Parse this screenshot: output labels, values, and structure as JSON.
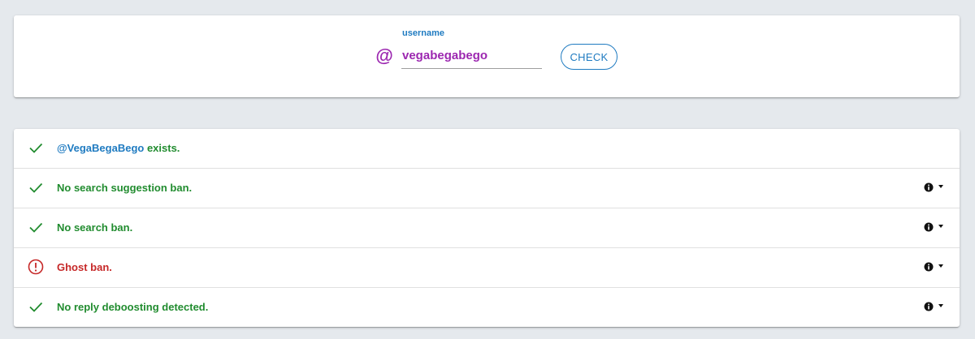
{
  "search": {
    "label": "username",
    "value": "vegabegabego",
    "at_symbol": "@",
    "check_label": "CHECK"
  },
  "results": [
    {
      "status": "ok",
      "handle": "@VegaBegaBego",
      "text": " exists.",
      "details": false
    },
    {
      "status": "ok",
      "handle": "",
      "text": "No search suggestion ban.",
      "details": true
    },
    {
      "status": "ok",
      "handle": "",
      "text": "No search ban.",
      "details": true
    },
    {
      "status": "warning",
      "handle": "",
      "text": "Ghost ban.",
      "details": true
    },
    {
      "status": "ok",
      "handle": "",
      "text": "No reply deboosting detected.",
      "details": true
    }
  ],
  "colors": {
    "background": "#e5e9ed",
    "accent_blue": "#1f7bc1",
    "accent_purple": "#9c27b0",
    "ok_green": "#218c2f",
    "warning_red": "#c62828",
    "input_text": "#9c27b0"
  },
  "icons": {
    "ok": "check-icon",
    "warning": "alert-circle-icon",
    "info": "info-icon",
    "expand": "caret-down-icon"
  }
}
